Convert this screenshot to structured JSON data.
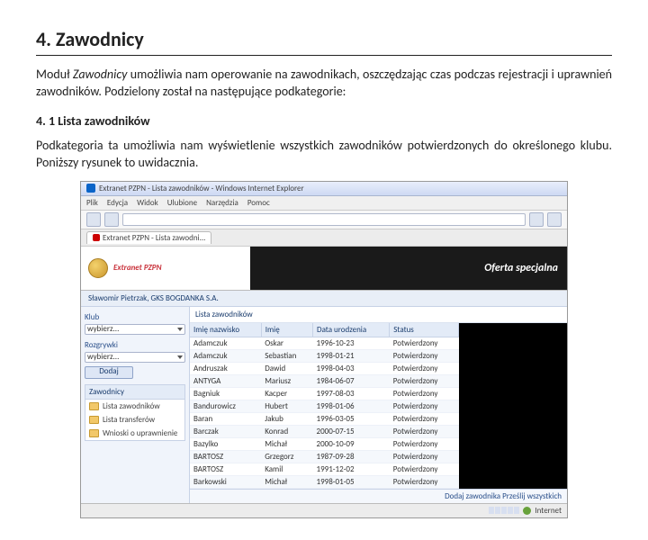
{
  "heading": "4. Zawodnicy",
  "para1_before": "Moduł ",
  "para1_italic": "Zawodnicy",
  "para1_after": " umożliwia nam operowanie na zawodnikach, oszczędzając czas podczas rejestracji i uprawnień zawodników. Podzielony został na następujące podkategorie:",
  "subheading": "4. 1 Lista zawodników",
  "para2": "Podkategoria ta umożliwia nam wyświetlenie wszystkich zawodników potwierdzonych do określonego klubu. Poniższy rysunek to uwidacznia.",
  "win": {
    "title": "Extranet PZPN - Lista zawodników - Windows Internet Explorer",
    "menu": [
      "Plik",
      "Edycja",
      "Widok",
      "Ulubione",
      "Narzędzia",
      "Pomoc"
    ],
    "address": "https://kluby.pzpn.pl/Players/List",
    "tab": "Extranet PZPN - Lista zawodni...",
    "brand": "Extranet PZPN",
    "ad_title": "Oferta specjalna",
    "breadcrumb": "Sławomir Pietrzak, GKS BOGDANKA S.A.",
    "sidebar": {
      "klub_label": "Klub",
      "klub_value": "wybierz...",
      "rozgr_label": "Rozgrywki",
      "rozgr_value": "wybierz...",
      "btn": "Dodaj",
      "section_header": "Zawodnicy",
      "items": [
        "Lista zawodników",
        "Lista transferów",
        "Wnioski o uprawnienie"
      ]
    },
    "table": {
      "title": "Lista zawodników",
      "headers": [
        "Imię nazwisko",
        "Imię",
        "Data urodzenia",
        "Status"
      ],
      "rows": [
        [
          "Adamczuk",
          "Oskar",
          "1996-10-23",
          "Potwierdzony"
        ],
        [
          "Adamczuk",
          "Sebastian",
          "1998-01-21",
          "Potwierdzony"
        ],
        [
          "Andruszak",
          "Dawid",
          "1998-04-03",
          "Potwierdzony"
        ],
        [
          "ANTYGA",
          "Mariusz",
          "1984-06-07",
          "Potwierdzony"
        ],
        [
          "Bagniuk",
          "Kacper",
          "1997-08-03",
          "Potwierdzony"
        ],
        [
          "Bandurowicz",
          "Hubert",
          "1998-01-06",
          "Potwierdzony"
        ],
        [
          "Baran",
          "Jakub",
          "1996-03-05",
          "Potwierdzony"
        ],
        [
          "Barczak",
          "Konrad",
          "2000-07-15",
          "Potwierdzony"
        ],
        [
          "Bazylko",
          "Michał",
          "2000-10-09",
          "Potwierdzony"
        ],
        [
          "BARTOSZ",
          "Grzegorz",
          "1987-09-28",
          "Potwierdzony"
        ],
        [
          "BARTOSZ",
          "Kamil",
          "1991-12-02",
          "Potwierdzony"
        ],
        [
          "Barkowski",
          "Michał",
          "1998-01-05",
          "Potwierdzony"
        ]
      ],
      "footer": "Dodaj zawodnika   Prześlij wszystkich"
    },
    "status": "Internet"
  }
}
